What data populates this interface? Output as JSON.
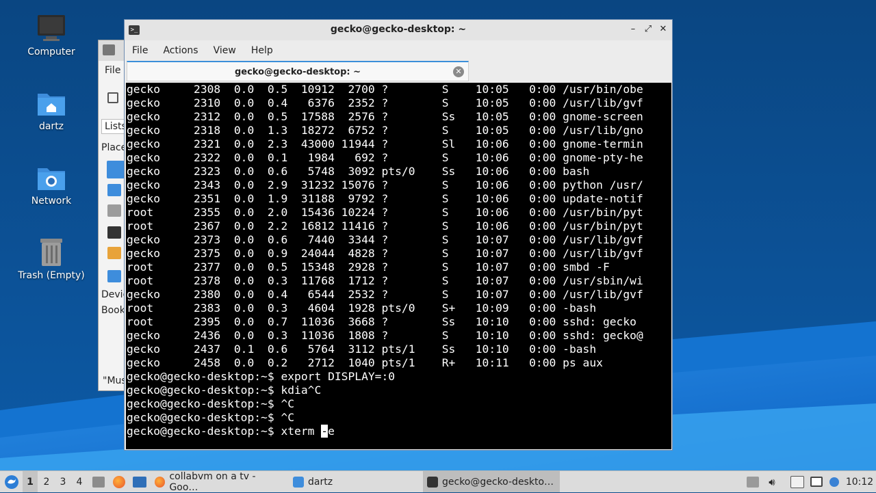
{
  "desktop": {
    "icons": [
      {
        "label": "Computer"
      },
      {
        "label": "dartz"
      },
      {
        "label": "Network"
      },
      {
        "label": "Trash (Empty)"
      }
    ]
  },
  "file_manager": {
    "menu_file": "File",
    "lists": "Lists",
    "places": "Place",
    "devices": "Devic",
    "bookmarks": "Book",
    "status": "\"Mus"
  },
  "terminal": {
    "title": "gecko@gecko-desktop: ~",
    "menu": [
      "File",
      "Actions",
      "View",
      "Help"
    ],
    "tab_title": "gecko@gecko-desktop: ~",
    "lines": [
      "gecko     2308  0.0  0.5  10912  2700 ?        S    10:05   0:00 /usr/bin/obe",
      "gecko     2310  0.0  0.4   6376  2352 ?        S    10:05   0:00 /usr/lib/gvf",
      "gecko     2312  0.0  0.5  17588  2576 ?        Ss   10:05   0:00 gnome-screen",
      "gecko     2318  0.0  1.3  18272  6752 ?        S    10:05   0:00 /usr/lib/gno",
      "gecko     2321  0.0  2.3  43000 11944 ?        Sl   10:06   0:00 gnome-termin",
      "gecko     2322  0.0  0.1   1984   692 ?        S    10:06   0:00 gnome-pty-he",
      "gecko     2323  0.0  0.6   5748  3092 pts/0    Ss   10:06   0:00 bash",
      "gecko     2343  0.0  2.9  31232 15076 ?        S    10:06   0:00 python /usr/",
      "gecko     2351  0.0  1.9  31188  9792 ?        S    10:06   0:00 update-notif",
      "root      2355  0.0  2.0  15436 10224 ?        S    10:06   0:00 /usr/bin/pyt",
      "root      2367  0.0  2.2  16812 11416 ?        S    10:06   0:00 /usr/bin/pyt",
      "gecko     2373  0.0  0.6   7440  3344 ?        S    10:07   0:00 /usr/lib/gvf",
      "gecko     2375  0.0  0.9  24044  4828 ?        S    10:07   0:00 /usr/lib/gvf",
      "root      2377  0.0  0.5  15348  2928 ?        S    10:07   0:00 smbd -F",
      "root      2378  0.0  0.3  11768  1712 ?        S    10:07   0:00 /usr/sbin/wi",
      "gecko     2380  0.0  0.4   6544  2532 ?        S    10:07   0:00 /usr/lib/gvf",
      "root      2383  0.0  0.3   4604  1928 pts/0    S+   10:09   0:00 -bash",
      "root      2395  0.0  0.7  11036  3668 ?        Ss   10:10   0:00 sshd: gecko",
      "gecko     2436  0.0  0.3  11036  1808 ?        S    10:10   0:00 sshd: gecko@",
      "gecko     2437  0.1  0.6   5764  3112 pts/1    Ss   10:10   0:00 -bash",
      "gecko     2458  0.0  0.2   2712  1040 pts/1    R+   10:11   0:00 ps aux",
      "gecko@gecko-desktop:~$ export DISPLAY=:0",
      "gecko@gecko-desktop:~$ kdia^C",
      "gecko@gecko-desktop:~$ ^C",
      "gecko@gecko-desktop:~$ ^C"
    ],
    "prompt_line_before": "gecko@gecko-desktop:~$ xterm ",
    "cursor_char": "-",
    "prompt_line_after": "e"
  },
  "taskbar": {
    "workspaces": [
      "1",
      "2",
      "3",
      "4"
    ],
    "active_workspace": "1",
    "tasks": [
      {
        "label": "collabvm on a tv - Goo…",
        "icon": "firefox-icon"
      },
      {
        "label": "dartz",
        "icon": "folder-icon"
      },
      {
        "label": "gecko@gecko-deskto…",
        "icon": "terminal-icon"
      }
    ],
    "clock": "10:12"
  }
}
